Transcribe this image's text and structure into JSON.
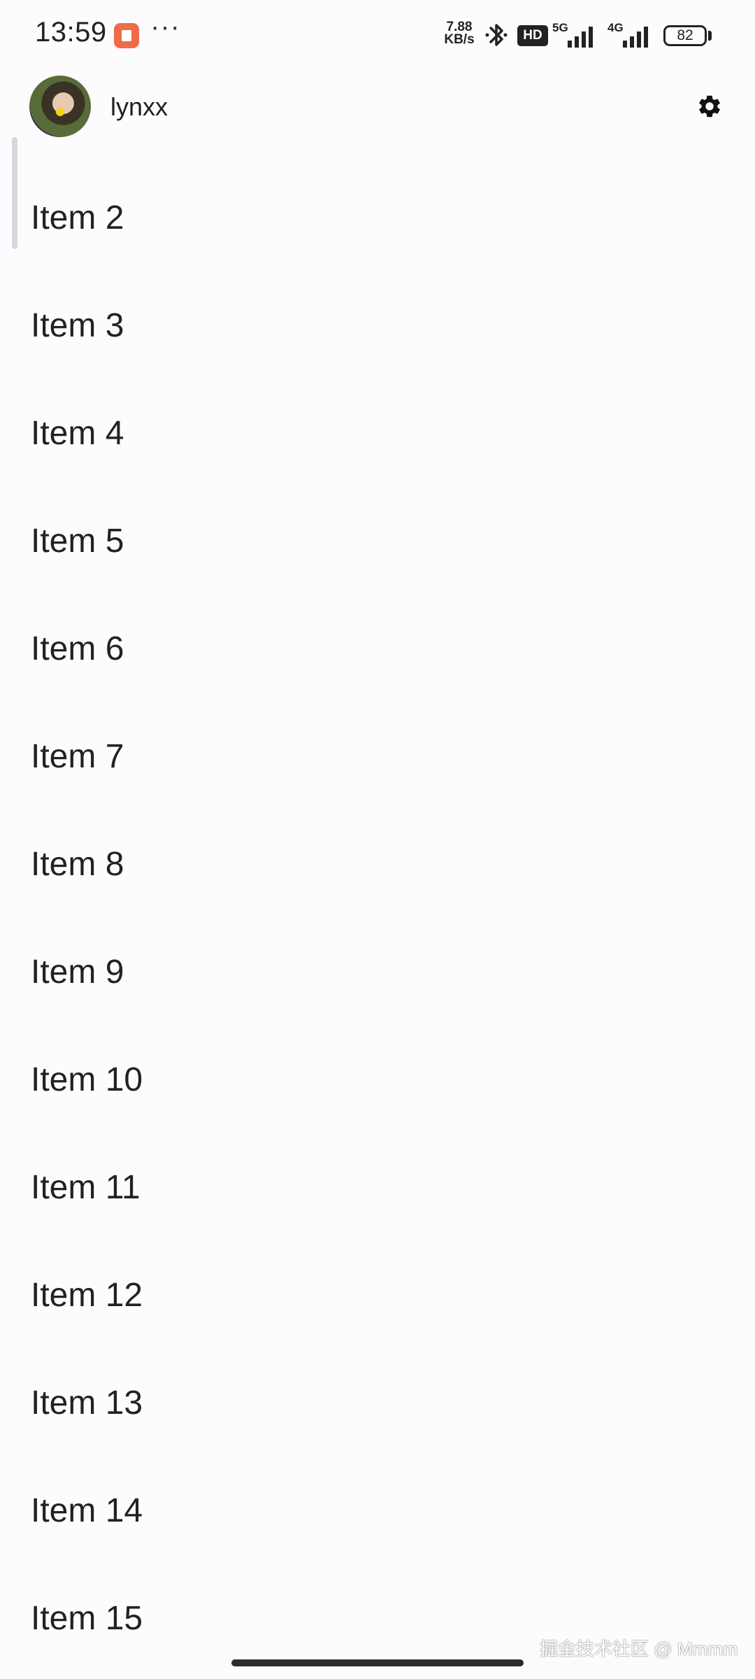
{
  "status_bar": {
    "time": "13:59",
    "more": "···",
    "net_speed_value": "7.88",
    "net_speed_unit": "KB/s",
    "hd": "HD",
    "net1": "5G",
    "net2": "4G",
    "battery": "82"
  },
  "header": {
    "username": "lynxx"
  },
  "list": {
    "items": [
      {
        "label": "Item 2"
      },
      {
        "label": "Item 3"
      },
      {
        "label": "Item 4"
      },
      {
        "label": "Item 5"
      },
      {
        "label": "Item 6"
      },
      {
        "label": "Item 7"
      },
      {
        "label": "Item 8"
      },
      {
        "label": "Item 9"
      },
      {
        "label": "Item 10"
      },
      {
        "label": "Item 11"
      },
      {
        "label": "Item 12"
      },
      {
        "label": "Item 13"
      },
      {
        "label": "Item 14"
      },
      {
        "label": "Item 15"
      }
    ]
  },
  "watermark": "掘金技术社区 @ Mmmm",
  "icons": {
    "settings": "gear-icon",
    "bluetooth": "bluetooth-icon",
    "app": "app-notification-icon"
  }
}
